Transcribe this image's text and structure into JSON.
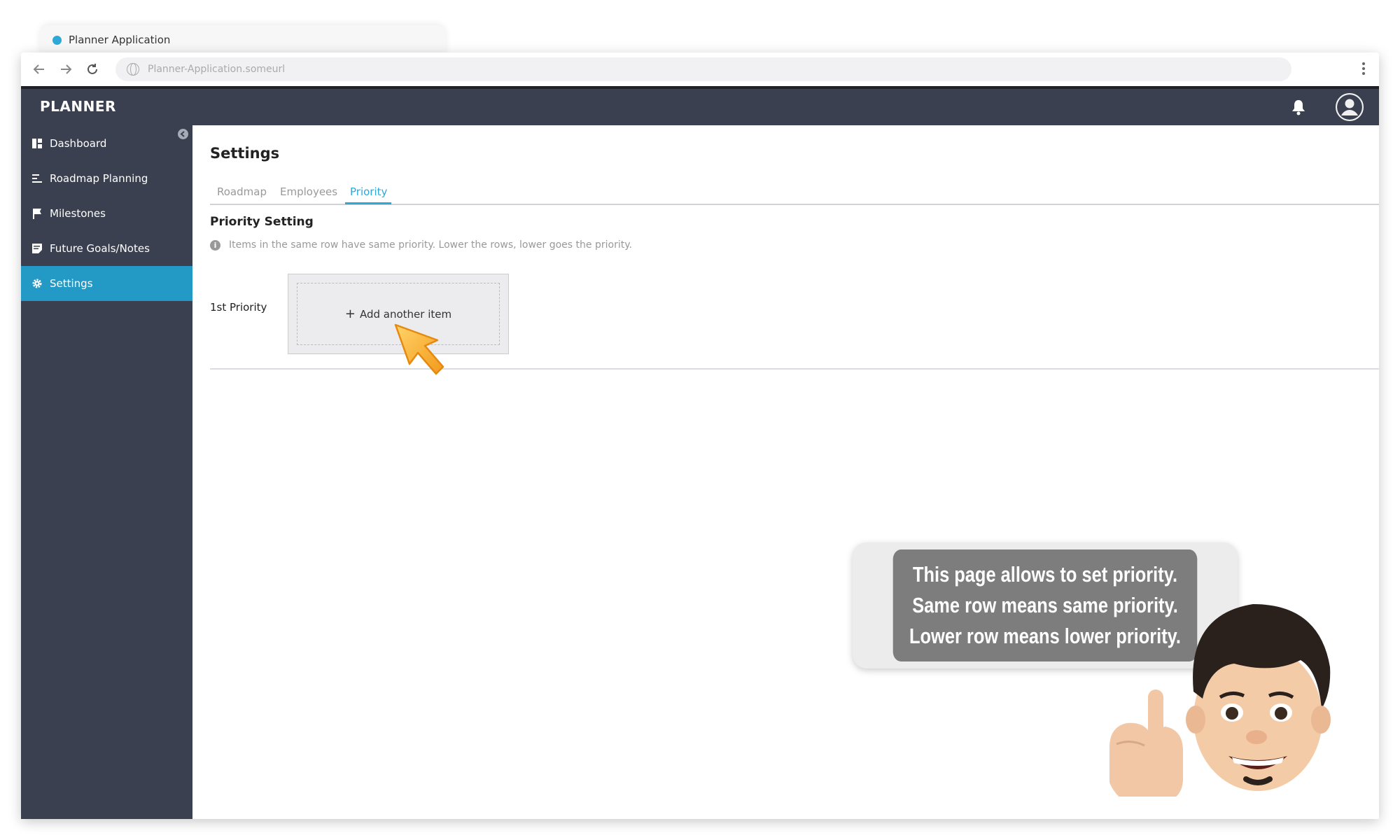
{
  "browser": {
    "tab_title": "Planner Application",
    "url": "Planner-Application.someurl"
  },
  "app": {
    "brand": "PLANNER"
  },
  "sidebar": {
    "items": [
      {
        "label": "Dashboard",
        "icon": "dashboard-icon",
        "active": false
      },
      {
        "label": "Roadmap Planning",
        "icon": "roadmap-icon",
        "active": false
      },
      {
        "label": "Milestones",
        "icon": "flag-icon",
        "active": false
      },
      {
        "label": "Future Goals/Notes",
        "icon": "notes-icon",
        "active": false
      },
      {
        "label": "Settings",
        "icon": "gear-icon",
        "active": true
      }
    ]
  },
  "main": {
    "title": "Settings",
    "tabs": [
      {
        "label": "Roadmap",
        "active": false
      },
      {
        "label": "Employees",
        "active": false
      },
      {
        "label": "Priority",
        "active": true
      }
    ],
    "section_title": "Priority Setting",
    "hint": "Items in the same row have same priority. Lower the rows, lower goes the priority.",
    "rows": [
      {
        "label": "1st Priority",
        "add_label": "Add another item"
      }
    ]
  },
  "tutorial": {
    "lines": [
      "This page allows to set priority.",
      "Same row  means same priority.",
      "Lower row means lower priority."
    ]
  },
  "colors": {
    "sidebar_bg": "#3b4050",
    "accent": "#239ac6",
    "active_tab": "#2ea8d6"
  }
}
